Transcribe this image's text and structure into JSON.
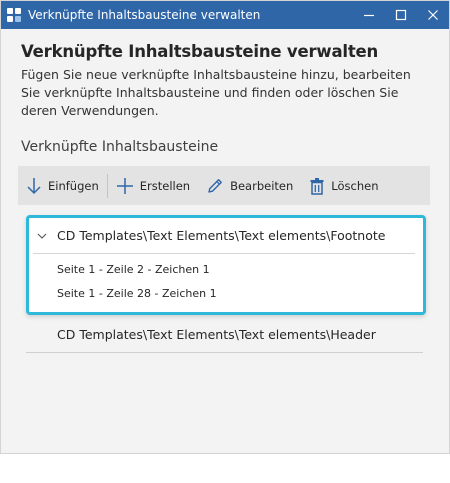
{
  "window": {
    "title": "Verknüpfte Inhaltsbausteine verwalten"
  },
  "header": {
    "title": "Verknüpfte Inhaltsbausteine verwalten",
    "description": "Fügen Sie neue verknüpfte Inhaltsbausteine hinzu, bearbeiten Sie verknüpfte Inhaltsbausteine und finden oder löschen Sie deren Verwendungen."
  },
  "section": {
    "label": "Verknüpfte Inhaltsbausteine"
  },
  "toolbar": {
    "insert_label": "Einfügen",
    "create_label": "Erstellen",
    "edit_label": "Bearbeiten",
    "delete_label": "Löschen"
  },
  "list": {
    "items": [
      {
        "title": "CD Templates\\Text Elements\\Text elements\\Footnote",
        "expanded": true,
        "selected": true,
        "usages": [
          "Seite 1 - Zeile 2 - Zeichen 1",
          "Seite 1 - Zeile 28 - Zeichen 1"
        ]
      },
      {
        "title": "CD Templates\\Text Elements\\Text elements\\Header",
        "expanded": false,
        "selected": false
      }
    ]
  },
  "colors": {
    "titlebar": "#2f66a8",
    "accent": "#2eb9d9",
    "icon_blue": "#2f66a8",
    "toolbar_bg": "#e3e3e3",
    "window_bg": "#f3f3f3"
  },
  "icons": {
    "app": "linked-blocks-icon",
    "insert": "arrow-down-icon",
    "create": "plus-icon",
    "edit": "pencil-icon",
    "delete": "trash-icon",
    "expand": "chevron-down-icon"
  }
}
